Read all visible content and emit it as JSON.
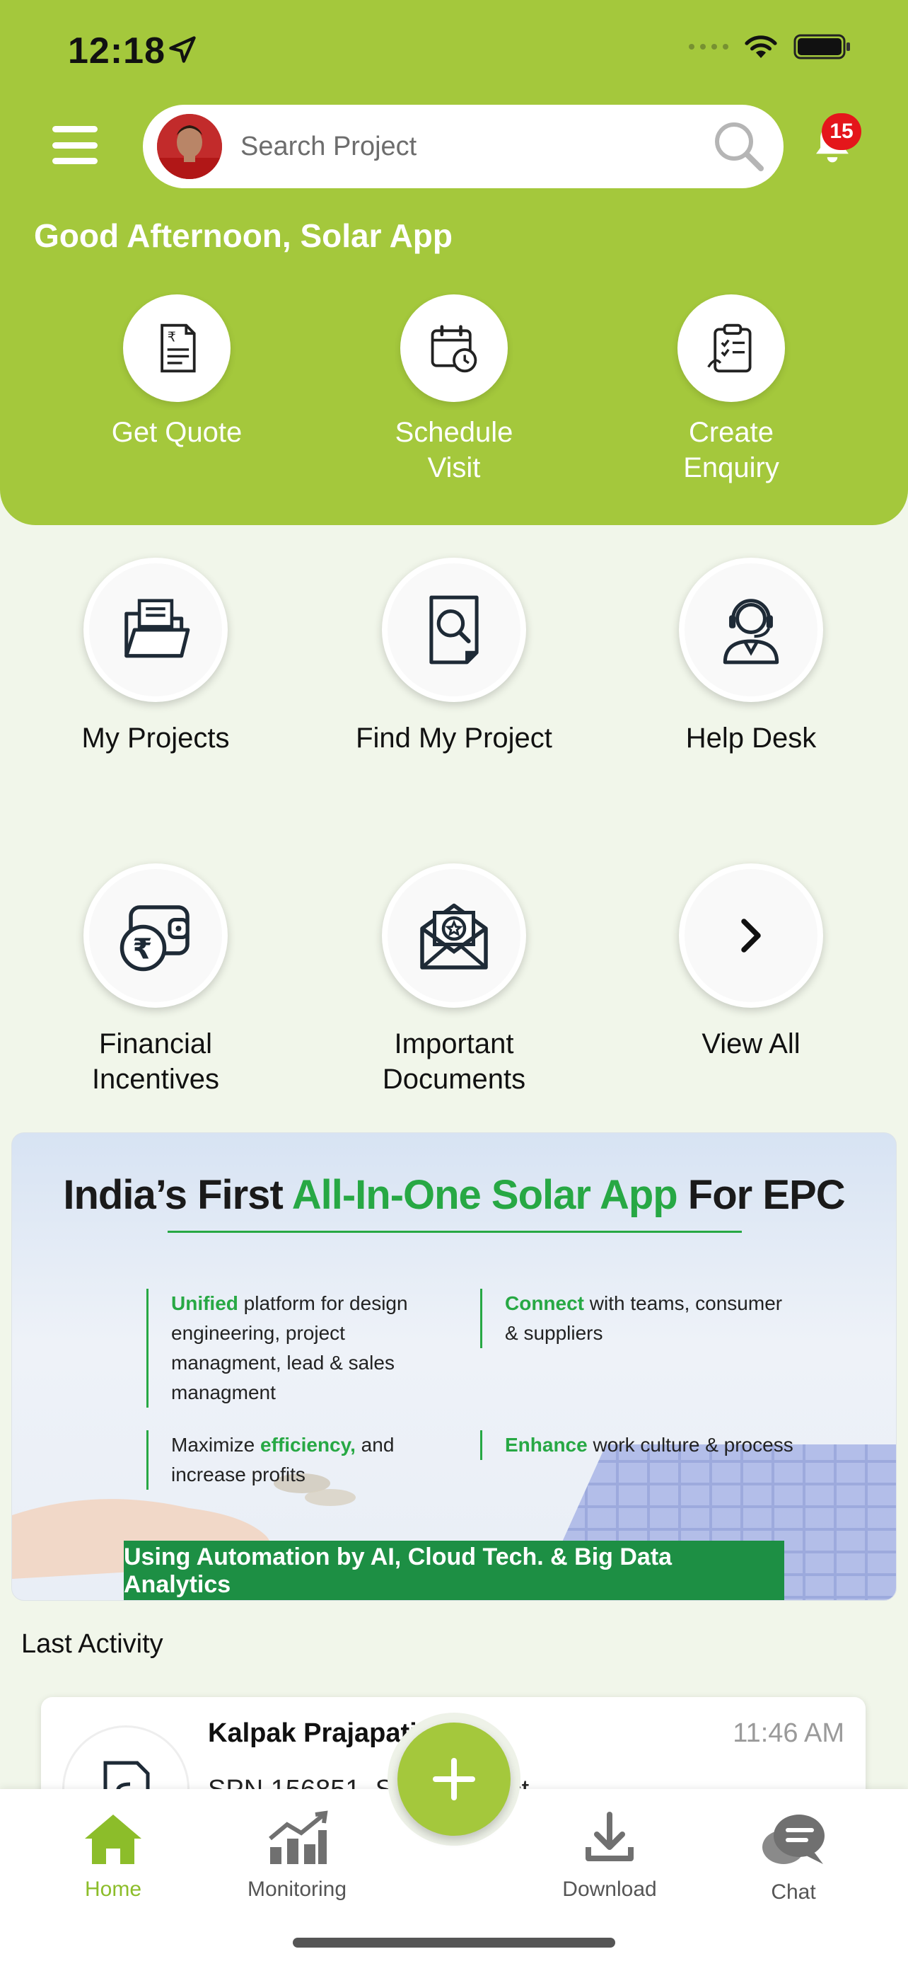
{
  "status_bar": {
    "time": "12:18"
  },
  "header": {
    "search_placeholder": "Search Project",
    "notification_count": "15",
    "greeting": "Good Afternoon, Solar App",
    "brand_color": "#a4c83c"
  },
  "quick_actions": [
    {
      "label": "Get Quote",
      "icon": "quote-document-icon"
    },
    {
      "label": "Schedule\nVisit",
      "icon": "calendar-clock-icon"
    },
    {
      "label": "Create\nEnquiry",
      "icon": "clipboard-checklist-icon"
    }
  ],
  "grid": [
    {
      "label": "My Projects",
      "icon": "folder-documents-icon"
    },
    {
      "label": "Find My Project",
      "icon": "document-search-icon"
    },
    {
      "label": "Help Desk",
      "icon": "headset-agent-icon"
    },
    {
      "label": "Financial\nIncentives",
      "icon": "wallet-rupee-icon"
    },
    {
      "label": "Important\nDocuments",
      "icon": "envelope-star-icon"
    },
    {
      "label": "View All",
      "icon": "chevron-right-icon"
    }
  ],
  "banner": {
    "title_part1": "India’s First ",
    "title_highlight": "All-In-One Solar App",
    "title_part2": " For EPC",
    "bullets": [
      {
        "key": "Unified",
        "text": " platform for design engineering, project managment, lead & sales managment"
      },
      {
        "key": "Connect",
        "text": " with teams, consumer & suppliers"
      },
      {
        "key_prefix": "Maximize ",
        "key": "efficiency,",
        "text": " and increase profits"
      },
      {
        "key": "Enhance",
        "text": " work culture & process"
      }
    ],
    "cta": "Using Automation by AI, Cloud Tech. & Big Data Analytics"
  },
  "last_activity": {
    "heading": "Last Activity",
    "items": [
      {
        "name": "Kalpak Prajapati Aha",
        "time": "11:46 AM",
        "subtitle": "SPN 156851, Solar Project"
      }
    ]
  },
  "bottom_nav": {
    "items": [
      {
        "label": "Home",
        "icon": "home-icon",
        "active": true
      },
      {
        "label": "Monitoring",
        "icon": "bar-chart-icon",
        "active": false
      },
      {
        "label": "Download",
        "icon": "download-icon",
        "active": false
      },
      {
        "label": "Chat",
        "icon": "chat-bubbles-icon",
        "active": false
      }
    ],
    "fab_icon": "plus-icon"
  }
}
